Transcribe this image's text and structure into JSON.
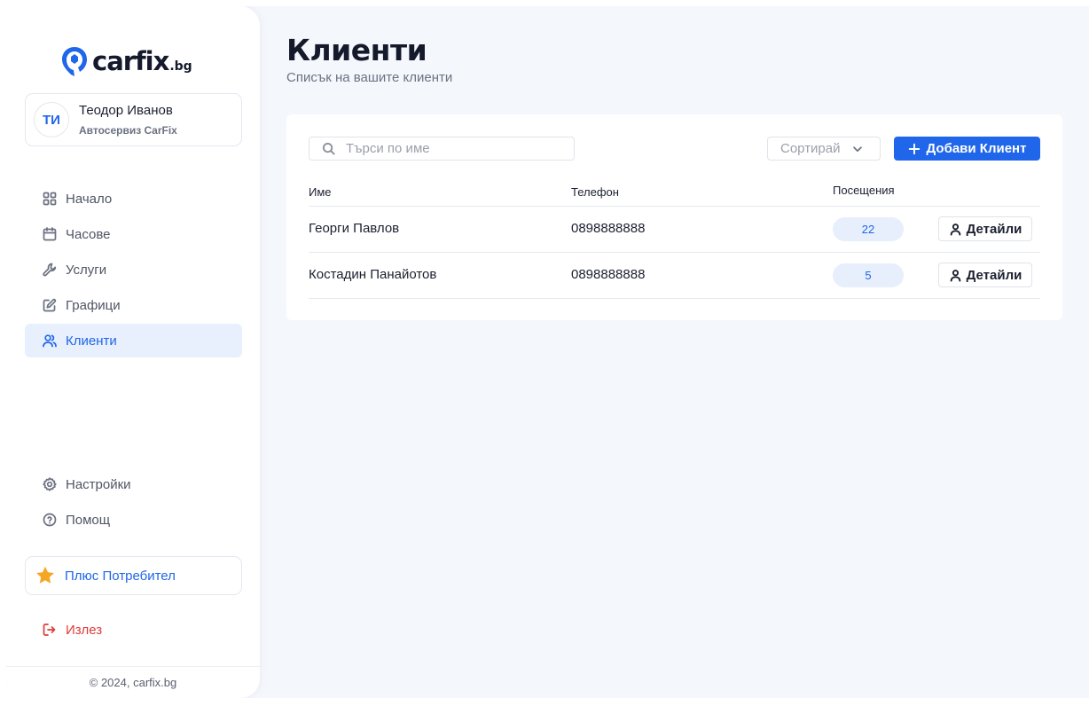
{
  "brand": {
    "name_part1": "car",
    "name_part2": "fix",
    "tld": ".bg",
    "accent_color": "#1f66ea"
  },
  "user": {
    "initials": "ТИ",
    "name": "Теодор Иванов",
    "company": "Автосервиз CarFix"
  },
  "nav": {
    "main": [
      {
        "label": "Начало",
        "icon": "grid-icon"
      },
      {
        "label": "Часове",
        "icon": "calendar-icon"
      },
      {
        "label": "Услуги",
        "icon": "wrench-icon"
      },
      {
        "label": "Графици",
        "icon": "edit-icon"
      },
      {
        "label": "Клиенти",
        "icon": "users-icon",
        "active": true
      }
    ],
    "bottom": [
      {
        "label": "Настройки",
        "icon": "gear-icon"
      },
      {
        "label": "Помощ",
        "icon": "help-icon"
      }
    ],
    "plus": {
      "label": "Плюс Потребител",
      "icon": "star-icon"
    },
    "logout": {
      "label": "Излез",
      "icon": "logout-icon"
    }
  },
  "footer": {
    "text": "© 2024, carfix.bg"
  },
  "page": {
    "title": "Клиенти",
    "subtitle": "Списък на вашите клиенти"
  },
  "toolbar": {
    "search_placeholder": "Търси по име",
    "search_value": "",
    "sort_label": "Сортирай",
    "add_label": "Добави Клиент"
  },
  "table": {
    "headers": {
      "name": "Име",
      "phone": "Телефон",
      "visits": "Посещения"
    },
    "rows": [
      {
        "name": "Георги Павлов",
        "phone": "0898888888",
        "visits": "22",
        "action": "Детайли"
      },
      {
        "name": "Костадин Панайотов",
        "phone": "0898888888",
        "visits": "5",
        "action": "Детайли"
      }
    ]
  }
}
